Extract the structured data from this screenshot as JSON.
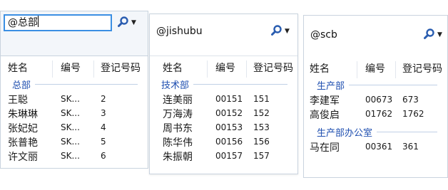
{
  "colors": {
    "accent": "#3b8fe3",
    "group_text": "#1f4fb0"
  },
  "icons": {
    "search": "magnifier-icon",
    "dropdown": "triangle-down-icon"
  },
  "panels": [
    {
      "query": "@总部",
      "headers": [
        "姓名",
        "编号",
        "登记号码"
      ],
      "groups": [
        {
          "name": "总部",
          "rows": [
            {
              "name": "王聪",
              "id": "SK...",
              "reg": "2"
            },
            {
              "name": "朱琳琳",
              "id": "SK...",
              "reg": "3"
            },
            {
              "name": "张妃妃",
              "id": "SK...",
              "reg": "4"
            },
            {
              "name": "张普艳",
              "id": "SK...",
              "reg": "5"
            },
            {
              "name": "许文丽",
              "id": "SK...",
              "reg": "6"
            }
          ]
        }
      ]
    },
    {
      "query": "@jishubu",
      "headers": [
        "姓名",
        "编号",
        "登记号码"
      ],
      "groups": [
        {
          "name": "技术部",
          "rows": [
            {
              "name": "连美丽",
              "id": "00151",
              "reg": "151"
            },
            {
              "name": "万海涛",
              "id": "00152",
              "reg": "152"
            },
            {
              "name": "周书东",
              "id": "00153",
              "reg": "153"
            },
            {
              "name": "陈华伟",
              "id": "00156",
              "reg": "156"
            },
            {
              "name": "朱振朝",
              "id": "00157",
              "reg": "157"
            }
          ]
        }
      ]
    },
    {
      "query": "@scb",
      "headers": [
        "姓名",
        "编号",
        "登记号码"
      ],
      "groups": [
        {
          "name": "生产部",
          "rows": [
            {
              "name": "李建军",
              "id": "00673",
              "reg": "673"
            },
            {
              "name": "高俊启",
              "id": "01762",
              "reg": "1762"
            }
          ]
        },
        {
          "name": "生产部办公室",
          "rows": [
            {
              "name": "马在同",
              "id": "00361",
              "reg": "361"
            }
          ]
        }
      ]
    }
  ]
}
